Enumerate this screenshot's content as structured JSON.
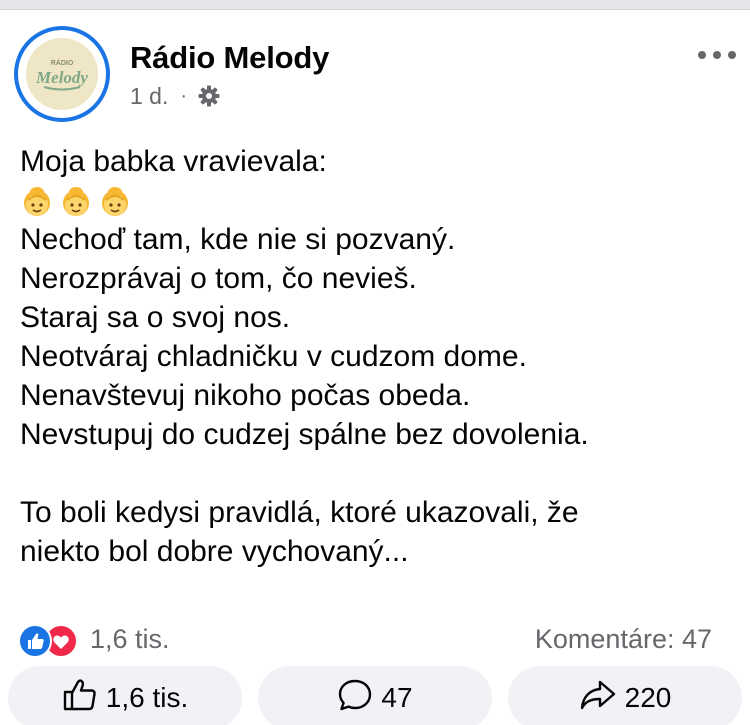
{
  "post": {
    "page_name": "Rádio Melody",
    "timestamp": "1 d.",
    "separator": "·",
    "avatar_text": "RÁDIO",
    "avatar_logo_text": "Melody",
    "privacy_icon": "gear-icon",
    "more_icon": "more-horizontal-icon",
    "body": {
      "line1": "Moja babka vravievala:",
      "emojis": [
        "older-woman-emoji",
        "older-woman-emoji",
        "older-woman-emoji"
      ],
      "line2": "Nechoď tam, kde nie si pozvaný.",
      "line3": "Nerozprávaj o tom, čo nevieš.",
      "line4": "Staraj sa o svoj nos.",
      "line5": "Neotváraj chladničku v cudzom dome.",
      "line6": "Nenavštevuj nikoho počas obeda.",
      "line7": "Nevstupuj do cudzej spálne bez dovolenia.",
      "line8": "To boli kedysi pravidlá, ktoré ukazovali, že",
      "line9": "niekto bol dobre vychovaný..."
    }
  },
  "stats": {
    "reaction_count": "1,6 tis.",
    "reaction_icons": [
      "like-reaction-icon",
      "love-reaction-icon"
    ],
    "comments": "Komentáre: 47"
  },
  "actions": {
    "like_count": "1,6 tis.",
    "comment_count": "47",
    "share_count": "220"
  },
  "colors": {
    "accent": "#1b74e4",
    "love": "#f02849",
    "secondary_text": "#65676b",
    "button_bg": "#f0f2f5"
  }
}
